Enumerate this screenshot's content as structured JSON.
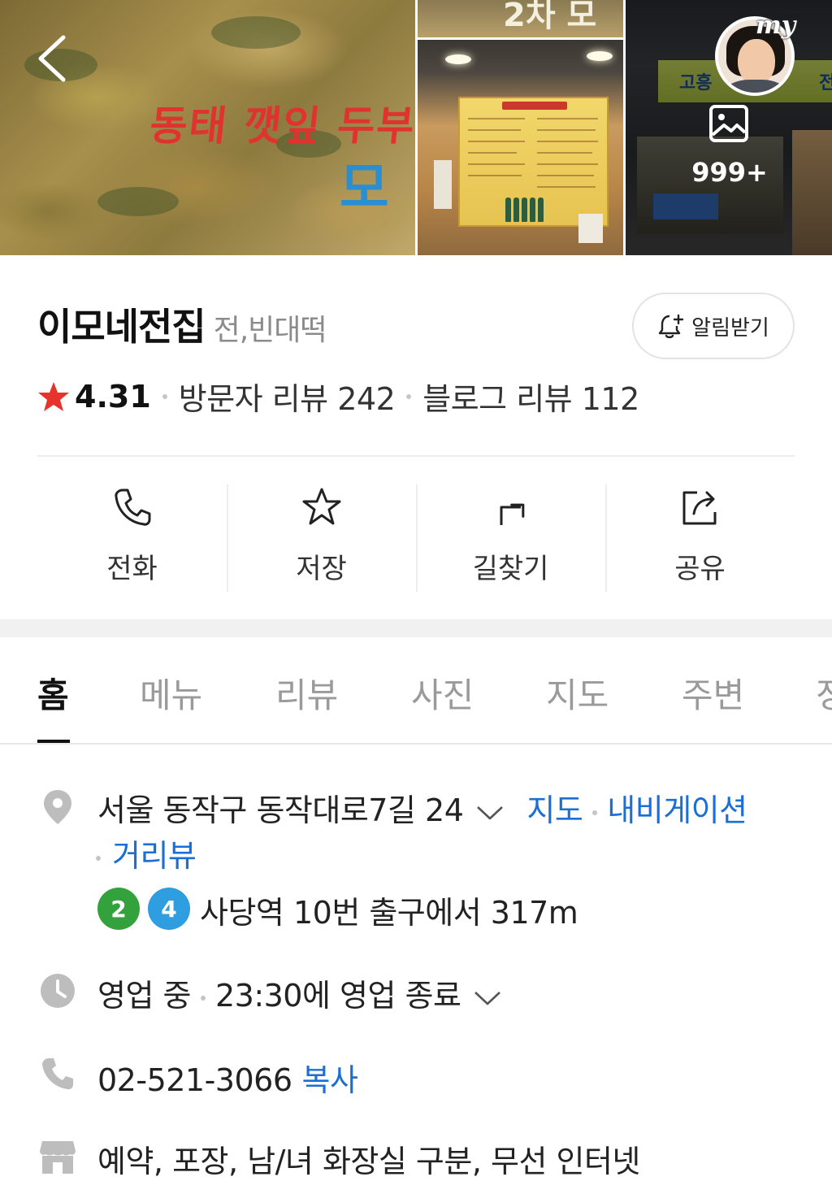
{
  "gallery": {
    "overlay_main_red": "동태 깻잎 두부",
    "overlay_main_blue": "모",
    "overlay_top": "2차 모",
    "right_sign_left": "고흥",
    "right_sign_right": "전집",
    "photo_count": "999+",
    "my_label": "my"
  },
  "place": {
    "name": "이모네전집",
    "category": "전,빈대떡",
    "notify_label": "알림받기",
    "rating": "4.31",
    "visitor_review": "방문자 리뷰 242",
    "blog_review": "블로그 리뷰 112",
    "star_color": "#e8322c"
  },
  "actions": [
    {
      "label": "전화",
      "icon": "phone-icon"
    },
    {
      "label": "저장",
      "icon": "star-icon"
    },
    {
      "label": "길찾기",
      "icon": "directions-icon"
    },
    {
      "label": "공유",
      "icon": "share-icon"
    }
  ],
  "tabs": [
    {
      "label": "홈",
      "active": true
    },
    {
      "label": "메뉴"
    },
    {
      "label": "리뷰"
    },
    {
      "label": "사진"
    },
    {
      "label": "지도"
    },
    {
      "label": "주변"
    },
    {
      "label": "정"
    }
  ],
  "info": {
    "address": "서울 동작구 동작대로7길 24",
    "map_link": "지도",
    "navigation_link": "내비게이션",
    "streetview_link": "거리뷰",
    "subway_lines": [
      {
        "number": "2",
        "color": "#33a23d"
      },
      {
        "number": "4",
        "color": "#2f9ee0"
      }
    ],
    "subway_text": "사당역 10번 출구에서 317m",
    "open_status": "영업 중",
    "close_text": "23:30에 영업 종료",
    "phone": "02-521-3066",
    "copy_label": "복사",
    "amenities": "예약, 포장, 남/녀 화장실 구분, 무선 인터넷",
    "link_color": "#1a6fd6"
  }
}
